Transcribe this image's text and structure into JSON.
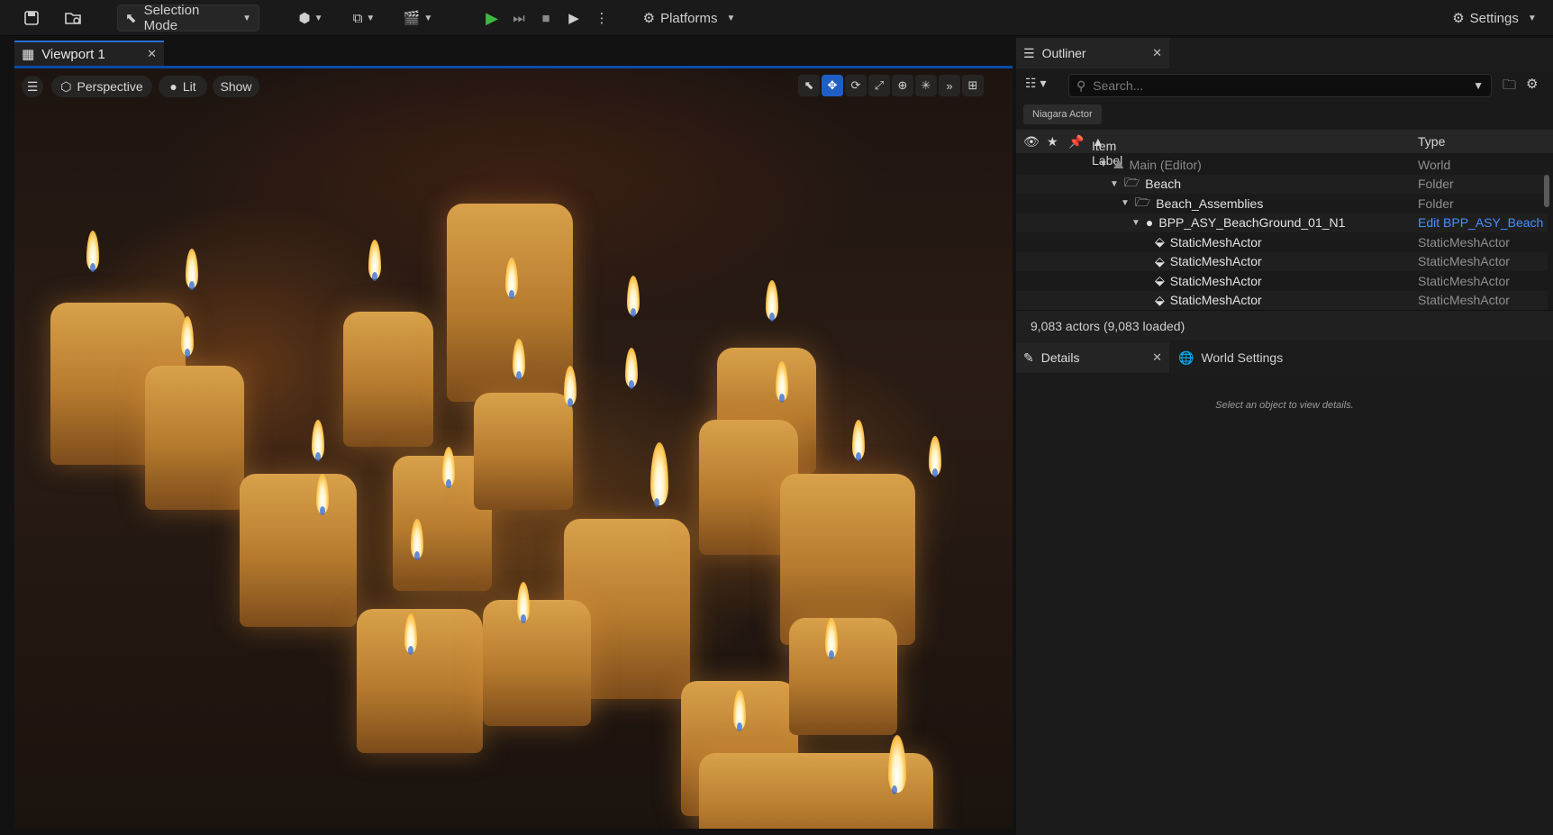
{
  "toolbar": {
    "selection_mode": "Selection Mode",
    "platforms": "Platforms",
    "settings": "Settings",
    "icons": [
      "save-icon",
      "content-browser-icon",
      "add-actor-icon",
      "blueprint-icon",
      "cinematics-icon",
      "play-icon",
      "step-icon",
      "stop-icon",
      "simulate-icon",
      "more-icon",
      "platforms-icon",
      "settings-gear-icon"
    ]
  },
  "viewport": {
    "tab_label": "Viewport 1",
    "perspective": "Perspective",
    "lit": "Lit",
    "show": "Show"
  },
  "outliner": {
    "tab_label": "Outliner",
    "search_placeholder": "Search...",
    "filter_chip": "Niagara Actor",
    "columns": {
      "label": "Item Label",
      "type": "Type"
    },
    "rows": [
      {
        "label": "Main (Editor)",
        "type": "World"
      },
      {
        "label": "Beach",
        "type": "Folder"
      },
      {
        "label": "Beach_Assemblies",
        "type": "Folder"
      },
      {
        "label": "BPP_ASY_BeachGround_01_N1",
        "type": "Edit BPP_ASY_Beach"
      },
      {
        "label": "StaticMeshActor",
        "type": "StaticMeshActor"
      },
      {
        "label": "StaticMeshActor",
        "type": "StaticMeshActor"
      },
      {
        "label": "StaticMeshActor",
        "type": "StaticMeshActor"
      },
      {
        "label": "StaticMeshActor",
        "type": "StaticMeshActor"
      }
    ],
    "status": "9,083 actors (9,083 loaded)"
  },
  "details": {
    "tab_label": "Details",
    "world_settings_label": "World Settings",
    "empty_message": "Select an object to view details."
  },
  "colors": {
    "accent": "#2a6fd6",
    "play": "#3fb93f",
    "link": "#4a8fff"
  }
}
